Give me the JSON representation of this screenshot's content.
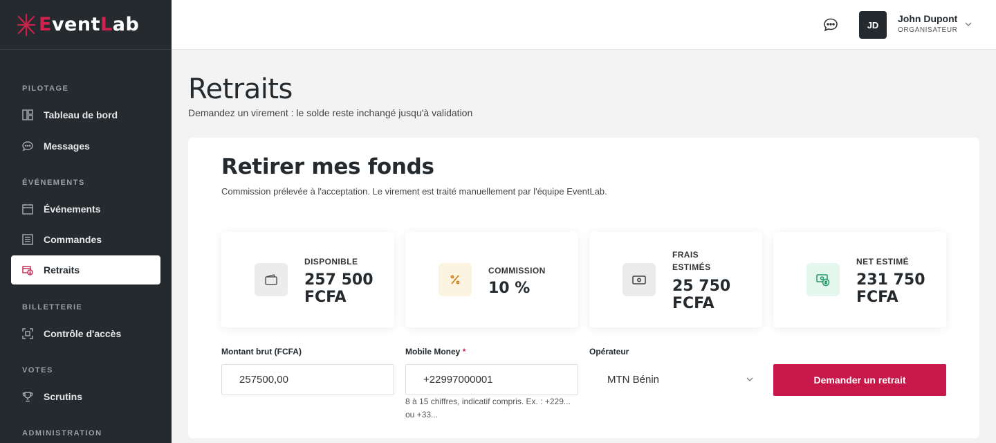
{
  "brand": {
    "name_part1": "E",
    "name_part2": "vent",
    "name_part3": "L",
    "name_part4": "ab"
  },
  "sidebar": {
    "sections": [
      {
        "title": "PILOTAGE"
      },
      {
        "title": "ÉVÉNEMENTS"
      },
      {
        "title": "BILLETTERIE"
      },
      {
        "title": "VOTES"
      },
      {
        "title": "ADMINISTRATION"
      }
    ],
    "items": [
      {
        "label": "Tableau de bord",
        "icon": "dashboard-icon"
      },
      {
        "label": "Messages",
        "icon": "message-icon"
      },
      {
        "label": "Événements",
        "icon": "calendar-icon"
      },
      {
        "label": "Commandes",
        "icon": "orders-icon"
      },
      {
        "label": "Retraits",
        "icon": "withdraw-icon",
        "active": true
      },
      {
        "label": "Contrôle d'accès",
        "icon": "scan-icon"
      },
      {
        "label": "Scrutins",
        "icon": "trophy-icon"
      }
    ]
  },
  "header": {
    "avatar_initials": "JD",
    "user_name": "John Dupont",
    "user_role": "ORGANISATEUR"
  },
  "page": {
    "title": "Retraits",
    "subtitle": "Demandez un virement : le solde reste inchangé jusqu'à validation"
  },
  "card": {
    "title": "Retirer mes fonds",
    "subtitle": "Commission prélevée à l'acceptation. Le virement est traité manuellement par l'équipe EventLab."
  },
  "stats": [
    {
      "label": "DISPONIBLE",
      "value": "257 500 FCFA",
      "icon": "wallet-icon",
      "tile_color": "#ececec",
      "icon_color": "#555555"
    },
    {
      "label": "COMMISSION",
      "value": "10 %",
      "icon": "percent-icon",
      "tile_color": "#fdf3e1",
      "icon_color": "#c77d12"
    },
    {
      "label": "FRAIS ESTIMÉS",
      "value": "25 750 FCFA",
      "icon": "cash-icon",
      "tile_color": "#ececec",
      "icon_color": "#444444"
    },
    {
      "label": "NET ESTIMÉ",
      "value": "231 750 FCFA",
      "icon": "money-icon",
      "tile_color": "#e4f6ee",
      "icon_color": "#1e9a62"
    }
  ],
  "form": {
    "amount_label": "Montant brut (FCFA)",
    "amount_value": "257500,00",
    "mobile_label": "Mobile Money",
    "mobile_required": "*",
    "mobile_value": "+22997000001",
    "mobile_hint": "8 à 15 chiffres, indicatif compris. Ex. : +229... ou +33...",
    "operator_label": "Opérateur",
    "operator_value": "MTN Bénin",
    "submit_label": "Demander un retrait"
  },
  "colors": {
    "accent": "#c8184a",
    "sidebar_bg": "#252a2e"
  }
}
